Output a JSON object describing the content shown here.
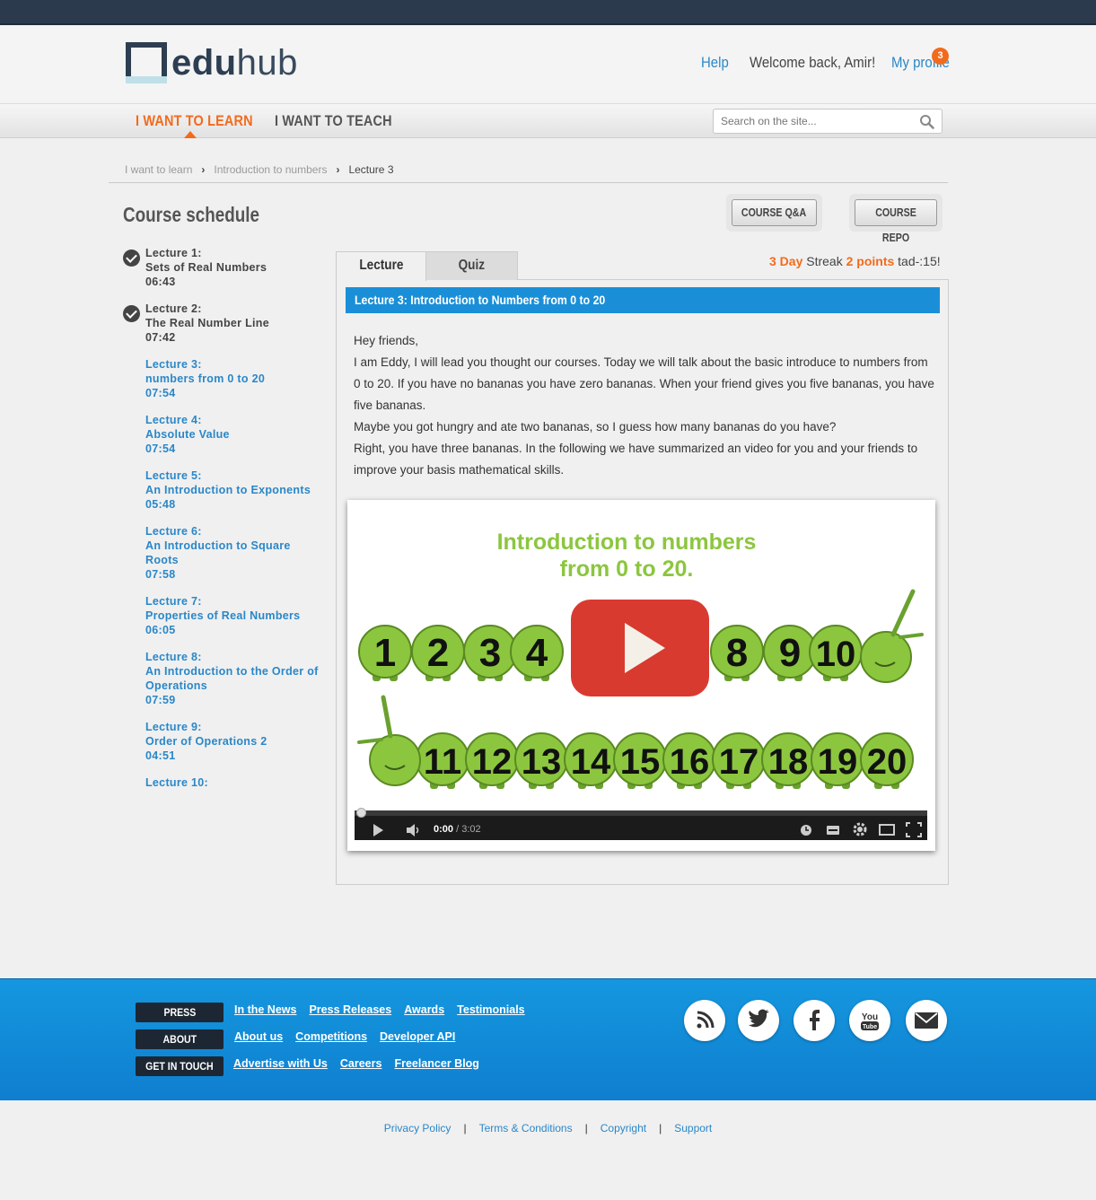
{
  "brand": {
    "logo_bold": "edu",
    "logo_light": "hub"
  },
  "header": {
    "help": "Help",
    "welcome": "Welcome back, Amir!",
    "profile": "My profile",
    "notif_count": "3"
  },
  "nav": {
    "learn": "I WANT TO LEARN",
    "teach": "I WANT TO TEACH"
  },
  "search": {
    "placeholder": "Search on the site..."
  },
  "breadcrumb": [
    "I want to learn",
    "Introduction to numbers",
    "Lecture 3"
  ],
  "schedule": {
    "title": "Course schedule",
    "buttons": {
      "qa": "COURSE Q&A",
      "repo": "COURSE REPO"
    }
  },
  "lectures": [
    {
      "num": "Lecture 1:",
      "name": "Sets of Real Numbers",
      "time": "06:43",
      "done": true
    },
    {
      "num": "Lecture 2:",
      "name": "The Real Number Line",
      "time": "07:42",
      "done": true
    },
    {
      "num": "Lecture 3:",
      "name": "numbers from 0 to 20",
      "time": "07:54",
      "done": false
    },
    {
      "num": "Lecture 4:",
      "name": "Absolute Value",
      "time": "07:54",
      "done": false
    },
    {
      "num": "Lecture 5:",
      "name": "An Introduction to Exponents",
      "time": "05:48",
      "done": false
    },
    {
      "num": "Lecture 6:",
      "name": "An Introduction to Square Roots",
      "time": "07:58",
      "done": false
    },
    {
      "num": "Lecture 7:",
      "name": "Properties of Real Numbers",
      "time": "06:05",
      "done": false
    },
    {
      "num": "Lecture 8:",
      "name": "An Introduction to the Order of Operations",
      "time": "07:59",
      "done": false
    },
    {
      "num": "Lecture 9:",
      "name": "Order of Operations 2",
      "time": "04:51",
      "done": false
    },
    {
      "num": "Lecture 10:",
      "name": "",
      "time": "",
      "done": false
    }
  ],
  "tabs": {
    "lecture": "Lecture",
    "quiz": "Quiz"
  },
  "streak": {
    "days": "3 Day",
    "streak_word": "Streak",
    "points": "2 points",
    "tail": "tad-:15!"
  },
  "lecture": {
    "heading": "Lecture 3: Introduction to Numbers from 0 to 20",
    "paragraphs": [
      "Hey friends,",
      "I am Eddy, I will lead you thought our courses. Today we will talk about the basic introduce to numbers from 0 to 20. If you have no bananas you have zero bananas. When your friend gives you five bananas, you have five bananas.",
      "Maybe you got hungry and ate two bananas, so I guess how many bananas do you have?",
      "Right, you have three bananas. In the following we have summarized an video for you and your friends to improve your basis mathematical skills."
    ]
  },
  "video": {
    "title_line1": "Introduction to numbers",
    "title_line2": "from 0 to 20.",
    "row1": [
      "1",
      "2",
      "3",
      "4",
      "8",
      "9",
      "10"
    ],
    "row2": [
      "11",
      "12",
      "13",
      "14",
      "15",
      "16",
      "17",
      "18",
      "19",
      "20"
    ],
    "current": "0:00",
    "duration": " / 3:02",
    "played_fraction": 0
  },
  "footer": {
    "rows": [
      {
        "badge": "PRESS",
        "links": [
          "In the News",
          "Press Releases",
          "Awards",
          "Testimonials"
        ]
      },
      {
        "badge": "ABOUT",
        "links": [
          "About us",
          "Competitions",
          "Developer API"
        ]
      },
      {
        "badge": "GET IN TOUCH",
        "links": [
          "Advertise with Us",
          "Careers",
          "Freelancer Blog"
        ]
      }
    ],
    "social": [
      "rss-icon",
      "twitter-icon",
      "facebook-icon",
      "youtube-icon",
      "mail-icon"
    ],
    "youtube_text": [
      "You",
      "Tube"
    ],
    "bottom": [
      "Privacy Policy",
      "Terms & Conditions",
      "Copyright",
      "Support"
    ]
  },
  "colors": {
    "accent": "#f26b1d",
    "link": "#2a87c8",
    "footer": "#1597df",
    "caterpillar": "#8cc63f"
  }
}
